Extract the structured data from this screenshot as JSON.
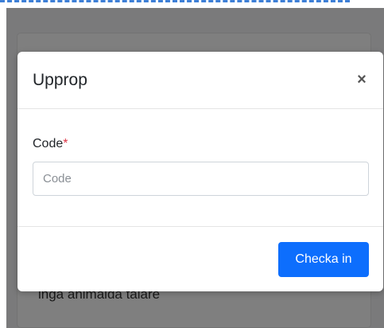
{
  "background": {
    "partial_text": "inga animalda talare"
  },
  "modal": {
    "title": "Upprop",
    "close_glyph": "×",
    "code_field": {
      "label": "Code",
      "required_mark": "*",
      "value": "",
      "placeholder": "Code"
    },
    "submit_label": "Checka in"
  },
  "colors": {
    "primary_button": "#0d6efd",
    "required_mark": "#dc3545",
    "overlay": "rgba(0,0,0,0.5)"
  }
}
